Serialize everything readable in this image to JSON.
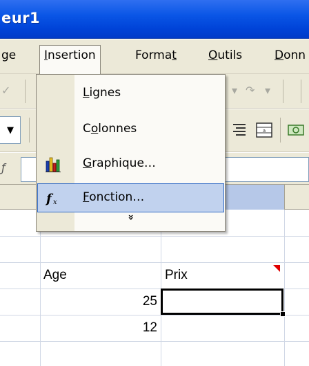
{
  "window": {
    "title_fragment": "eur1"
  },
  "menubar": {
    "items": [
      {
        "pre": "",
        "u": "",
        "post": "ge"
      },
      {
        "pre": "",
        "u": "I",
        "post": "nsertion"
      },
      {
        "pre": "Forma",
        "u": "t",
        "post": ""
      },
      {
        "pre": "",
        "u": "O",
        "post": "utils"
      },
      {
        "pre": "",
        "u": "D",
        "post": "onn"
      }
    ]
  },
  "insert_menu": {
    "items": [
      {
        "pre": "",
        "u": "L",
        "post": "ignes",
        "icon": "none"
      },
      {
        "pre": "C",
        "u": "o",
        "post": "lonnes",
        "icon": "none"
      },
      {
        "pre": "",
        "u": "G",
        "post": "raphique…",
        "icon": "chart-icon"
      },
      {
        "pre": "",
        "u": "F",
        "post": "onction…",
        "icon": "function-icon"
      }
    ],
    "expand_glyph": "»"
  },
  "sheet": {
    "headers_row": {
      "age": "Age",
      "prix": "Prix"
    },
    "age_values": [
      "25",
      "12"
    ]
  },
  "colors": {
    "titlebar": "#0a56e6",
    "menu_highlight": "#c1d2ee",
    "menu_highlight_border": "#316ac5",
    "selected_column_header": "#b6c8e8",
    "comment_marker": "#e00000"
  }
}
